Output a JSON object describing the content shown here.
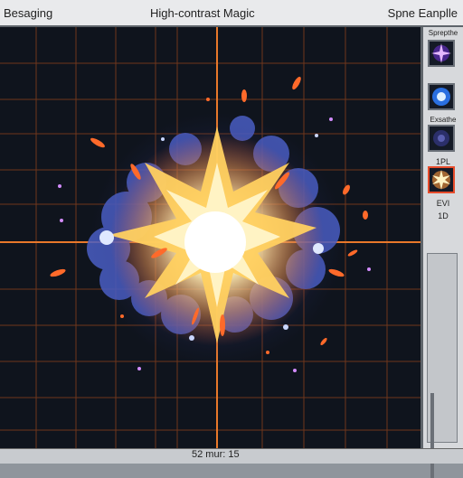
{
  "titlebar": {
    "left": "Besaging",
    "center": "High-contrast Magic",
    "right": "Spne Eanplle"
  },
  "side_panel": {
    "labels": [
      "Sprepthe",
      "Exsathe",
      "1PL",
      "EVI",
      "1D"
    ],
    "selected_thumb": 4
  },
  "status": {
    "text": "52 mur: 15"
  },
  "colors": {
    "grid_line": "#e8782a",
    "canvas_bg": "#0f141d",
    "smoke": "#4a5fc4",
    "burst_core": "#fff6d8",
    "burst_glow": "#ffd060",
    "spark": "#ff6a2a"
  }
}
